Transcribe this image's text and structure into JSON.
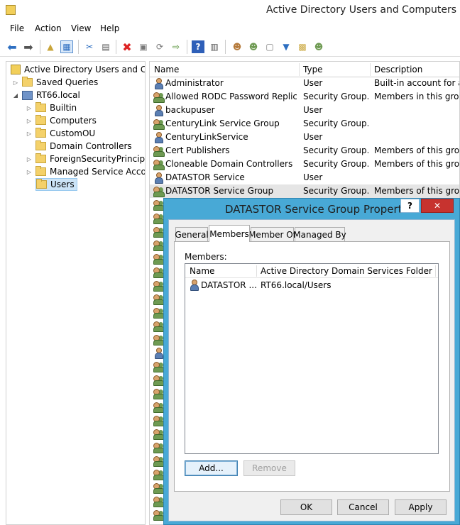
{
  "window": {
    "title": "Active Directory Users and Computers"
  },
  "menu": [
    "File",
    "Action",
    "View",
    "Help"
  ],
  "toolbar_icons": [
    "back-arrow-icon",
    "forward-arrow-icon",
    "up-folder-icon",
    "console-tree-icon",
    "cut-icon",
    "clipboard-icon",
    "delete-icon",
    "properties-icon",
    "refresh-icon",
    "export-list-icon",
    "help-icon",
    "action-pane-icon",
    "new-user-icon",
    "new-group-icon",
    "new-ou-icon",
    "filter-icon",
    "find-icon",
    "add-to-group-icon"
  ],
  "tree": {
    "root": "Active Directory Users and Com",
    "saved_queries": "Saved Queries",
    "domain": "RT66.local",
    "children": [
      "Builtin",
      "Computers",
      "CustomOU",
      "Domain Controllers",
      "ForeignSecurityPrincipals",
      "Managed Service Accour",
      "Users"
    ]
  },
  "list": {
    "headers": {
      "name": "Name",
      "type": "Type",
      "description": "Description"
    },
    "rows": [
      {
        "name": "Administrator",
        "type": "User",
        "description": "Built-in account for ad...",
        "icon": "user"
      },
      {
        "name": "Allowed RODC Password Replicat...",
        "type": "Security Group...",
        "description": "Members in this group c",
        "icon": "group"
      },
      {
        "name": "backupuser",
        "type": "User",
        "description": "",
        "icon": "user"
      },
      {
        "name": "CenturyLink Service Group",
        "type": "Security Group...",
        "description": "",
        "icon": "group"
      },
      {
        "name": "CenturyLinkService",
        "type": "User",
        "description": "",
        "icon": "user"
      },
      {
        "name": "Cert Publishers",
        "type": "Security Group...",
        "description": "Members of this group",
        "icon": "group"
      },
      {
        "name": "Cloneable Domain Controllers",
        "type": "Security Group...",
        "description": "Members of this group",
        "icon": "group"
      },
      {
        "name": "DATASTOR Service",
        "type": "User",
        "description": "",
        "icon": "user"
      },
      {
        "name": "DATASTOR Service Group",
        "type": "Security Group...",
        "description": "Members of this group",
        "icon": "group"
      }
    ]
  },
  "dialog": {
    "title": "DATASTOR Service Group Properties",
    "help_label": "?",
    "close_label": "✕",
    "tabs": [
      "General",
      "Members",
      "Member Of",
      "Managed By"
    ],
    "members_label": "Members:",
    "members_headers": {
      "name": "Name",
      "folder": "Active Directory Domain Services Folder"
    },
    "members": [
      {
        "name": "DATASTOR ...",
        "folder": "RT66.local/Users"
      }
    ],
    "add_label": "Add...",
    "remove_label": "Remove",
    "ok_label": "OK",
    "cancel_label": "Cancel",
    "apply_label": "Apply"
  }
}
